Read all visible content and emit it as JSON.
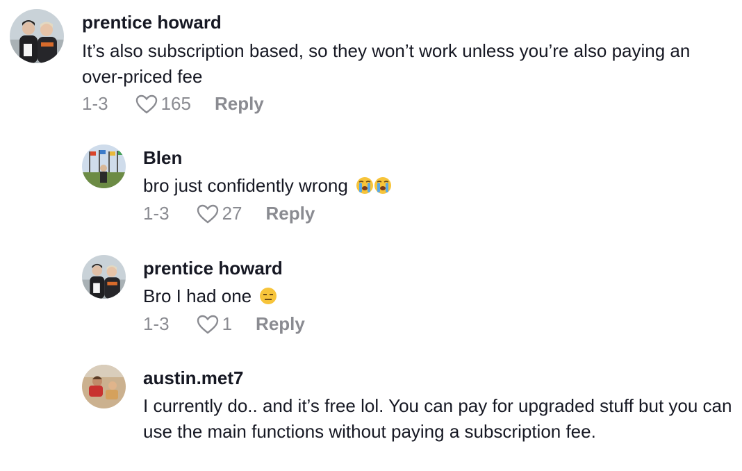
{
  "comments": [
    {
      "username": "prentice howard",
      "text": "It’s also subscription based, so they won’t work unless you’re also paying an over-priced fee",
      "date": "1-3",
      "likes": "165",
      "reply_label": "Reply",
      "avatar_icon": "avatar-two-people-icon"
    },
    {
      "username": "Blen",
      "text": "bro just confidently wrong",
      "date": "1-3",
      "likes": "27",
      "reply_label": "Reply",
      "avatar_icon": "avatar-flags-icon",
      "emoji": [
        "loudly-crying-face",
        "loudly-crying-face"
      ]
    },
    {
      "username": "prentice howard",
      "text": "Bro I had one",
      "date": "1-3",
      "likes": "1",
      "reply_label": "Reply",
      "avatar_icon": "avatar-two-people-icon",
      "emoji": [
        "expressionless-face"
      ]
    },
    {
      "username": "austin.met7",
      "text": "I currently do.. and it’s free lol. You can pay for upgraded stuff but you can use the main functions without paying a subscription fee.",
      "date": "",
      "likes": "",
      "reply_label": "",
      "avatar_icon": "avatar-beach-icon"
    }
  ]
}
